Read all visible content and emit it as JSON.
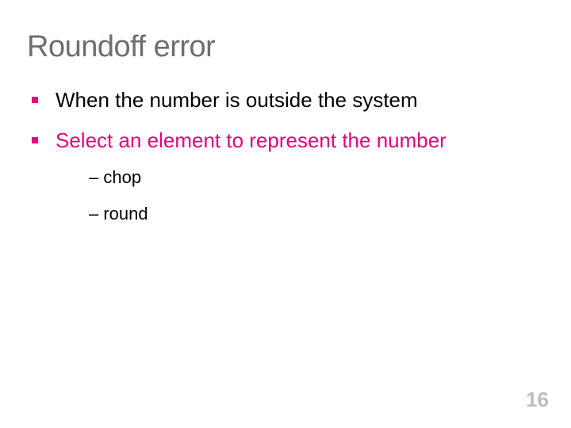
{
  "title": "Roundoff error",
  "bullets": [
    {
      "text": "When the number is outside the system"
    },
    {
      "text": "Select an element to represent the number"
    }
  ],
  "subitems": [
    {
      "text": "– chop"
    },
    {
      "text": "– round"
    }
  ],
  "page_number": "16"
}
